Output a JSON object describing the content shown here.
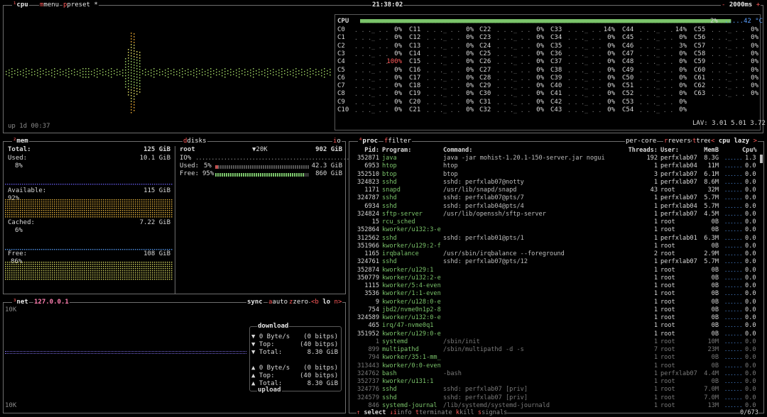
{
  "topbar": {
    "cpu": "cpu",
    "menu": "menu",
    "preset": "preset *",
    "clock": "21:38:02",
    "interval": "2000ms"
  },
  "cpu": {
    "label": "CPU",
    "total_pct": "2%",
    "temp": "42 °C",
    "uptime": "up 1d 00:37",
    "lav": "LAV: 3.01 5.01 3.72",
    "cols": [
      [
        [
          "C0",
          "0%"
        ],
        [
          "C1",
          "0%"
        ],
        [
          "C2",
          "0%"
        ],
        [
          "C3",
          "0%"
        ],
        [
          "C4",
          "100%"
        ],
        [
          "C5",
          "0%"
        ],
        [
          "C6",
          "0%"
        ],
        [
          "C7",
          "0%"
        ],
        [
          "C8",
          "0%"
        ],
        [
          "C9",
          "0%"
        ],
        [
          "C10",
          "0%"
        ]
      ],
      [
        [
          "C11",
          "0%"
        ],
        [
          "C12",
          "0%"
        ],
        [
          "C13",
          "0%"
        ],
        [
          "C14",
          "0%"
        ],
        [
          "C15",
          "0%"
        ],
        [
          "C16",
          "0%"
        ],
        [
          "C17",
          "0%"
        ],
        [
          "C18",
          "0%"
        ],
        [
          "C19",
          "0%"
        ],
        [
          "C20",
          "0%"
        ],
        [
          "C21",
          "0%"
        ]
      ],
      [
        [
          "C22",
          "0%"
        ],
        [
          "C23",
          "0%"
        ],
        [
          "C24",
          "0%"
        ],
        [
          "C25",
          "0%"
        ],
        [
          "C26",
          "0%"
        ],
        [
          "C27",
          "0%"
        ],
        [
          "C28",
          "0%"
        ],
        [
          "C29",
          "0%"
        ],
        [
          "C30",
          "0%"
        ],
        [
          "C31",
          "0%"
        ],
        [
          "C32",
          "0%"
        ]
      ],
      [
        [
          "C33",
          "14%"
        ],
        [
          "C34",
          "0%"
        ],
        [
          "C35",
          "0%"
        ],
        [
          "C36",
          "0%"
        ],
        [
          "C37",
          "0%"
        ],
        [
          "C38",
          "0%"
        ],
        [
          "C39",
          "0%"
        ],
        [
          "C40",
          "0%"
        ],
        [
          "C41",
          "0%"
        ],
        [
          "C42",
          "0%"
        ],
        [
          "C43",
          "0%"
        ]
      ],
      [
        [
          "C44",
          "14%"
        ],
        [
          "C45",
          "0%"
        ],
        [
          "C46",
          "3%"
        ],
        [
          "C47",
          "0%"
        ],
        [
          "C48",
          "0%"
        ],
        [
          "C49",
          "0%"
        ],
        [
          "C50",
          "0%"
        ],
        [
          "C51",
          "0%"
        ],
        [
          "C52",
          "0%"
        ],
        [
          "C53",
          "0%"
        ],
        [
          "C54",
          "0%"
        ]
      ],
      [
        [
          "C55",
          "0%"
        ],
        [
          "C56",
          "0%"
        ],
        [
          "C57",
          "0%"
        ],
        [
          "C58",
          "0%"
        ],
        [
          "C59",
          "0%"
        ],
        [
          "C60",
          "0%"
        ],
        [
          "C61",
          "0%"
        ],
        [
          "C62",
          "0%"
        ],
        [
          "C63",
          "0%"
        ]
      ]
    ]
  },
  "mem": {
    "title": "mem",
    "total_label": "Total:",
    "total": "125 GiB",
    "used_label": "Used:",
    "used": "10.1 GiB",
    "used_pct": "8%",
    "avail_label": "Available:",
    "avail": "115 GiB",
    "avail_pct": "92%",
    "cached_label": "Cached:",
    "cached": "7.22 GiB",
    "cached_pct": "6%",
    "free_label": "Free:",
    "free": "108 GiB",
    "free_pct": "86%"
  },
  "disks": {
    "title": "disks",
    "mode": "io",
    "name": "root",
    "speed": "▼20K",
    "size": "902 GiB",
    "io_label": "IO%",
    "used_label": "Used:",
    "used_pct": "5%",
    "used": "42.3 GiB",
    "free_label": "Free:",
    "free_pct": "95%",
    "free": "860 GiB"
  },
  "net": {
    "title": "net",
    "iface": "127.0.0.1",
    "sync": "sync",
    "auto": "auto",
    "zero": "zero",
    "nav": "<b lo n>",
    "scale_top": "10K",
    "scale_bottom": "10K",
    "download": "download",
    "upload": "upload",
    "rows": [
      [
        "▼ 0 Byte/s",
        "(0 bitps)"
      ],
      [
        "▼ Top:",
        "(40 bitps)"
      ],
      [
        "▼ Total:",
        "8.30 GiB"
      ],
      [
        "▲ 0 Byte/s",
        "(0 bitps)"
      ],
      [
        "▲ Top:",
        "(40 bitps)"
      ],
      [
        "▲ Total:",
        "8.30 GiB"
      ]
    ]
  },
  "proc": {
    "title": "proc",
    "filter": "filter",
    "percore": "per-core",
    "reverse": "reverse",
    "tree": "tree",
    "sort": "cpu lazy",
    "headers": {
      "pid": "Pid:",
      "program": "Program:",
      "command": "Command:",
      "threads": "Threads:",
      "user": "User:",
      "mem": "MemB",
      "cpu": "Cpu%"
    },
    "rows": [
      [
        "352871",
        "java",
        "java -jar mohist-1.20.1-150-server.jar nogui",
        "192",
        "perfxlab07",
        "8.3G",
        "1.3"
      ],
      [
        "6953",
        "htop",
        "htop",
        "1",
        "perfxlab04",
        "11M",
        "0.0"
      ],
      [
        "352510",
        "btop",
        "btop",
        "3",
        "perfxlab07",
        "6.1M",
        "0.0"
      ],
      [
        "324823",
        "sshd",
        "sshd: perfxlab07@notty",
        "1",
        "perfxlab07",
        "8.6M",
        "0.0"
      ],
      [
        "1171",
        "snapd",
        "/usr/lib/snapd/snapd",
        "43",
        "root",
        "32M",
        "0.0"
      ],
      [
        "324787",
        "sshd",
        "sshd: perfxlab07@pts/7",
        "1",
        "perfxlab07",
        "5.7M",
        "0.0"
      ],
      [
        "6934",
        "sshd",
        "sshd: perfxlab04@pts/4",
        "1",
        "perfxlab04",
        "5.7M",
        "0.0"
      ],
      [
        "324824",
        "sftp-server",
        "/usr/lib/openssh/sftp-server",
        "1",
        "perfxlab07",
        "4.5M",
        "0.0"
      ],
      [
        "15",
        "rcu_sched",
        "",
        "1",
        "root",
        "0B",
        "0.0"
      ],
      [
        "352864",
        "kworker/u132:3-e",
        "",
        "1",
        "root",
        "0B",
        "0.0"
      ],
      [
        "312562",
        "sshd",
        "sshd: perfxlab01@pts/1",
        "1",
        "perfxlab01",
        "6.3M",
        "0.0"
      ],
      [
        "351966",
        "kworker/u129:2-f",
        "",
        "1",
        "root",
        "0B",
        "0.0"
      ],
      [
        "1165",
        "irqbalance",
        "/usr/sbin/irqbalance --foreground",
        "2",
        "root",
        "2.9M",
        "0.0"
      ],
      [
        "324761",
        "sshd",
        "sshd: perfxlab07@pts/12",
        "1",
        "perfxlab07",
        "5.7M",
        "0.0"
      ],
      [
        "352874",
        "kworker/u129:1",
        "",
        "1",
        "root",
        "0B",
        "0.0"
      ],
      [
        "350779",
        "kworker/u132:2-e",
        "",
        "1",
        "root",
        "0B",
        "0.0"
      ],
      [
        "1115",
        "kworker/5:4-even",
        "",
        "1",
        "root",
        "0B",
        "0.0"
      ],
      [
        "3536",
        "kworker/1:1-even",
        "",
        "1",
        "root",
        "0B",
        "0.0"
      ],
      [
        "9",
        "kworker/u128:0-e",
        "",
        "1",
        "root",
        "0B",
        "0.0"
      ],
      [
        "754",
        "jbd2/nvme0n1p2-8",
        "",
        "1",
        "root",
        "0B",
        "0.0"
      ],
      [
        "324589",
        "kworker/u132:0-e",
        "",
        "1",
        "root",
        "0B",
        "0.0"
      ],
      [
        "465",
        "irq/47-nvme0q1",
        "",
        "1",
        "root",
        "0B",
        "0.0"
      ],
      [
        "351952",
        "kworker/u129:0-e",
        "",
        "1",
        "root",
        "0B",
        "0.0"
      ],
      [
        "1",
        "systemd",
        "/sbin/init",
        "1",
        "root",
        "10M",
        "0.0"
      ],
      [
        "899",
        "multipathd",
        "/sbin/multipathd -d -s",
        "7",
        "root",
        "23M",
        "0.0"
      ],
      [
        "794",
        "kworker/35:1-mm_",
        "",
        "1",
        "root",
        "0B",
        "0.0"
      ],
      [
        "313443",
        "kworker/0:0-even",
        "",
        "1",
        "root",
        "0B",
        "0.0"
      ],
      [
        "324762",
        "bash",
        "-bash",
        "1",
        "perfxlab07",
        "4.4M",
        "0.0"
      ],
      [
        "352737",
        "kworker/u131:1",
        "",
        "1",
        "root",
        "0B",
        "0.0"
      ],
      [
        "324776",
        "sshd",
        "sshd: perfxlab07 [priv]",
        "1",
        "root",
        "7.0M",
        "0.0"
      ],
      [
        "324579",
        "sshd",
        "sshd: perfxlab07 [priv]",
        "1",
        "root",
        "7.0M",
        "0.0"
      ],
      [
        "846",
        "systemd-journal",
        "/lib/systemd/systemd-journald",
        "1",
        "root",
        "13M",
        "0.0"
      ]
    ],
    "footer": {
      "select": "select",
      "info": "info",
      "terminate": "terminate",
      "kill": "kill",
      "signals": "signals",
      "count": "0/673"
    }
  },
  "colors": {
    "border": "#6e6e6e",
    "hotkey": "#ff5a5a",
    "green": "#7ac36a",
    "blue": "#5aa0ff",
    "yellow": "#d8c54a"
  }
}
